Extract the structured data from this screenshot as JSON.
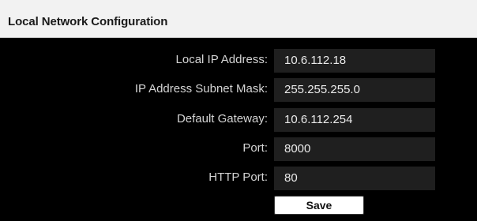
{
  "header": {
    "title": "Local Network Configuration"
  },
  "form": {
    "fields": [
      {
        "label": "Local IP Address:",
        "value": "10.6.112.18"
      },
      {
        "label": "IP Address Subnet Mask:",
        "value": "255.255.255.0"
      },
      {
        "label": "Default Gateway:",
        "value": "10.6.112.254"
      },
      {
        "label": "Port:",
        "value": "8000"
      },
      {
        "label": "HTTP Port:",
        "value": "80"
      }
    ],
    "save_label": "Save"
  },
  "colors": {
    "header_background": "#f2f2f2",
    "panel_background": "#000000",
    "field_background": "#1f1f1f",
    "label_text": "#d4d4d4",
    "button_background": "#ffffff"
  }
}
